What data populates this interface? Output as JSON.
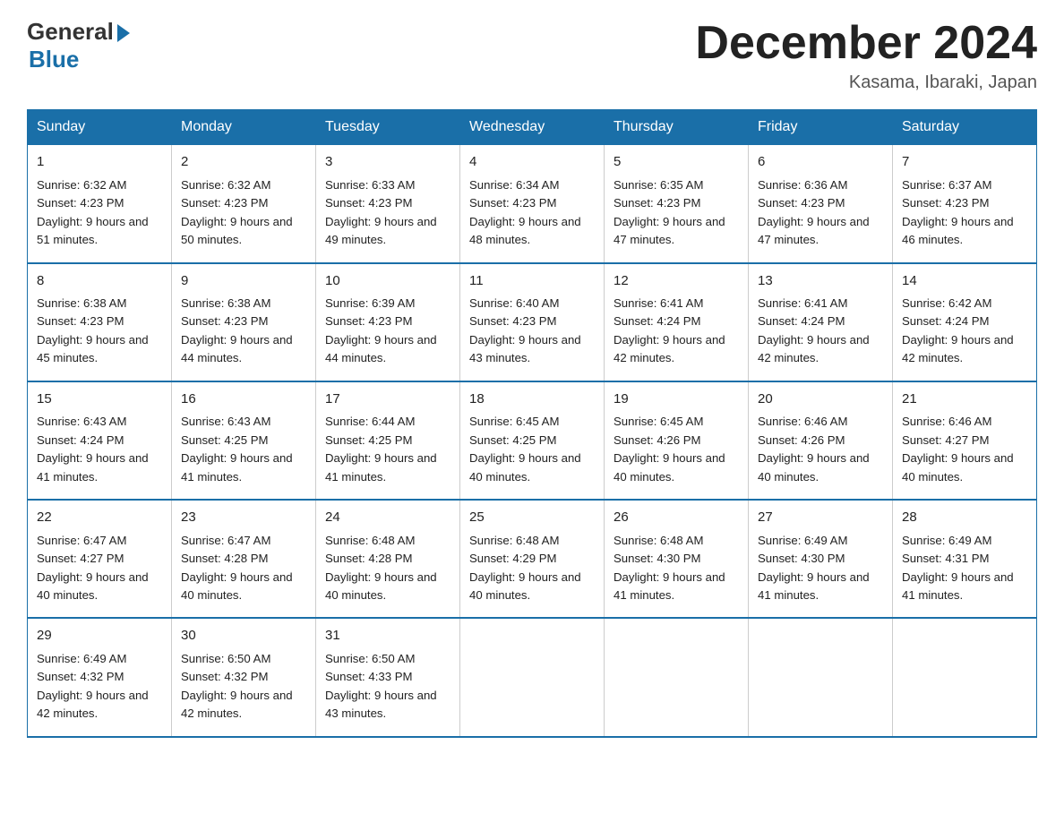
{
  "header": {
    "logo_general": "General",
    "logo_blue": "Blue",
    "month_title": "December 2024",
    "location": "Kasama, Ibaraki, Japan"
  },
  "weekdays": [
    "Sunday",
    "Monday",
    "Tuesday",
    "Wednesday",
    "Thursday",
    "Friday",
    "Saturday"
  ],
  "weeks": [
    [
      {
        "day": "1",
        "sunrise": "Sunrise: 6:32 AM",
        "sunset": "Sunset: 4:23 PM",
        "daylight": "Daylight: 9 hours and 51 minutes."
      },
      {
        "day": "2",
        "sunrise": "Sunrise: 6:32 AM",
        "sunset": "Sunset: 4:23 PM",
        "daylight": "Daylight: 9 hours and 50 minutes."
      },
      {
        "day": "3",
        "sunrise": "Sunrise: 6:33 AM",
        "sunset": "Sunset: 4:23 PM",
        "daylight": "Daylight: 9 hours and 49 minutes."
      },
      {
        "day": "4",
        "sunrise": "Sunrise: 6:34 AM",
        "sunset": "Sunset: 4:23 PM",
        "daylight": "Daylight: 9 hours and 48 minutes."
      },
      {
        "day": "5",
        "sunrise": "Sunrise: 6:35 AM",
        "sunset": "Sunset: 4:23 PM",
        "daylight": "Daylight: 9 hours and 47 minutes."
      },
      {
        "day": "6",
        "sunrise": "Sunrise: 6:36 AM",
        "sunset": "Sunset: 4:23 PM",
        "daylight": "Daylight: 9 hours and 47 minutes."
      },
      {
        "day": "7",
        "sunrise": "Sunrise: 6:37 AM",
        "sunset": "Sunset: 4:23 PM",
        "daylight": "Daylight: 9 hours and 46 minutes."
      }
    ],
    [
      {
        "day": "8",
        "sunrise": "Sunrise: 6:38 AM",
        "sunset": "Sunset: 4:23 PM",
        "daylight": "Daylight: 9 hours and 45 minutes."
      },
      {
        "day": "9",
        "sunrise": "Sunrise: 6:38 AM",
        "sunset": "Sunset: 4:23 PM",
        "daylight": "Daylight: 9 hours and 44 minutes."
      },
      {
        "day": "10",
        "sunrise": "Sunrise: 6:39 AM",
        "sunset": "Sunset: 4:23 PM",
        "daylight": "Daylight: 9 hours and 44 minutes."
      },
      {
        "day": "11",
        "sunrise": "Sunrise: 6:40 AM",
        "sunset": "Sunset: 4:23 PM",
        "daylight": "Daylight: 9 hours and 43 minutes."
      },
      {
        "day": "12",
        "sunrise": "Sunrise: 6:41 AM",
        "sunset": "Sunset: 4:24 PM",
        "daylight": "Daylight: 9 hours and 42 minutes."
      },
      {
        "day": "13",
        "sunrise": "Sunrise: 6:41 AM",
        "sunset": "Sunset: 4:24 PM",
        "daylight": "Daylight: 9 hours and 42 minutes."
      },
      {
        "day": "14",
        "sunrise": "Sunrise: 6:42 AM",
        "sunset": "Sunset: 4:24 PM",
        "daylight": "Daylight: 9 hours and 42 minutes."
      }
    ],
    [
      {
        "day": "15",
        "sunrise": "Sunrise: 6:43 AM",
        "sunset": "Sunset: 4:24 PM",
        "daylight": "Daylight: 9 hours and 41 minutes."
      },
      {
        "day": "16",
        "sunrise": "Sunrise: 6:43 AM",
        "sunset": "Sunset: 4:25 PM",
        "daylight": "Daylight: 9 hours and 41 minutes."
      },
      {
        "day": "17",
        "sunrise": "Sunrise: 6:44 AM",
        "sunset": "Sunset: 4:25 PM",
        "daylight": "Daylight: 9 hours and 41 minutes."
      },
      {
        "day": "18",
        "sunrise": "Sunrise: 6:45 AM",
        "sunset": "Sunset: 4:25 PM",
        "daylight": "Daylight: 9 hours and 40 minutes."
      },
      {
        "day": "19",
        "sunrise": "Sunrise: 6:45 AM",
        "sunset": "Sunset: 4:26 PM",
        "daylight": "Daylight: 9 hours and 40 minutes."
      },
      {
        "day": "20",
        "sunrise": "Sunrise: 6:46 AM",
        "sunset": "Sunset: 4:26 PM",
        "daylight": "Daylight: 9 hours and 40 minutes."
      },
      {
        "day": "21",
        "sunrise": "Sunrise: 6:46 AM",
        "sunset": "Sunset: 4:27 PM",
        "daylight": "Daylight: 9 hours and 40 minutes."
      }
    ],
    [
      {
        "day": "22",
        "sunrise": "Sunrise: 6:47 AM",
        "sunset": "Sunset: 4:27 PM",
        "daylight": "Daylight: 9 hours and 40 minutes."
      },
      {
        "day": "23",
        "sunrise": "Sunrise: 6:47 AM",
        "sunset": "Sunset: 4:28 PM",
        "daylight": "Daylight: 9 hours and 40 minutes."
      },
      {
        "day": "24",
        "sunrise": "Sunrise: 6:48 AM",
        "sunset": "Sunset: 4:28 PM",
        "daylight": "Daylight: 9 hours and 40 minutes."
      },
      {
        "day": "25",
        "sunrise": "Sunrise: 6:48 AM",
        "sunset": "Sunset: 4:29 PM",
        "daylight": "Daylight: 9 hours and 40 minutes."
      },
      {
        "day": "26",
        "sunrise": "Sunrise: 6:48 AM",
        "sunset": "Sunset: 4:30 PM",
        "daylight": "Daylight: 9 hours and 41 minutes."
      },
      {
        "day": "27",
        "sunrise": "Sunrise: 6:49 AM",
        "sunset": "Sunset: 4:30 PM",
        "daylight": "Daylight: 9 hours and 41 minutes."
      },
      {
        "day": "28",
        "sunrise": "Sunrise: 6:49 AM",
        "sunset": "Sunset: 4:31 PM",
        "daylight": "Daylight: 9 hours and 41 minutes."
      }
    ],
    [
      {
        "day": "29",
        "sunrise": "Sunrise: 6:49 AM",
        "sunset": "Sunset: 4:32 PM",
        "daylight": "Daylight: 9 hours and 42 minutes."
      },
      {
        "day": "30",
        "sunrise": "Sunrise: 6:50 AM",
        "sunset": "Sunset: 4:32 PM",
        "daylight": "Daylight: 9 hours and 42 minutes."
      },
      {
        "day": "31",
        "sunrise": "Sunrise: 6:50 AM",
        "sunset": "Sunset: 4:33 PM",
        "daylight": "Daylight: 9 hours and 43 minutes."
      },
      null,
      null,
      null,
      null
    ]
  ]
}
